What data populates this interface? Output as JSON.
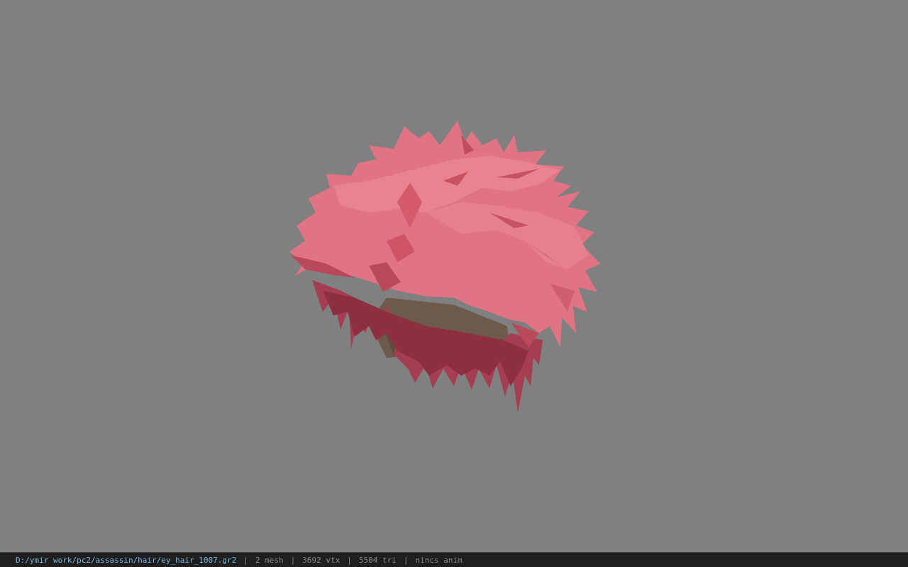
{
  "viewport": {
    "background": "#808080",
    "model_colors": {
      "hair": "#e07484",
      "hair_shadow": "#b94a5a",
      "hair_dark": "#8e2f3f",
      "scalp": "#6d5a4a"
    }
  },
  "status_bar": {
    "file_path": "D:/ymir work/pc2/assassin/hair/ey_hair_1007.gr2",
    "separator": "|",
    "mesh_count": "2 mesh",
    "vertex_count": "3692 vtx",
    "triangle_count": "5504 tri",
    "anim_status": "nincs anim"
  }
}
